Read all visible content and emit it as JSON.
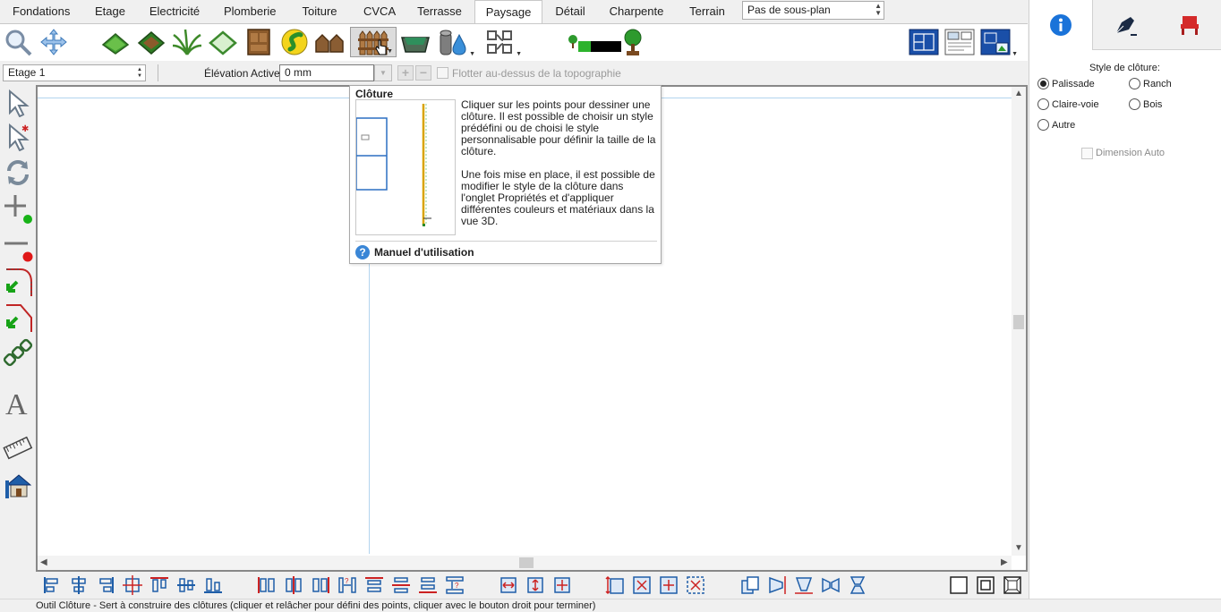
{
  "menu": {
    "tabs": [
      {
        "label": "Fondations"
      },
      {
        "label": "Etage"
      },
      {
        "label": "Electricité"
      },
      {
        "label": "Plomberie"
      },
      {
        "label": "Toiture"
      },
      {
        "label": "CVCA"
      },
      {
        "label": "Terrasse"
      },
      {
        "label": "Paysage",
        "active": true
      },
      {
        "label": "Détail"
      },
      {
        "label": "Charpente"
      },
      {
        "label": "Terrain"
      }
    ],
    "subplan_select": "Pas de sous-plan"
  },
  "toolbar": {
    "icons": [
      "zoom-icon",
      "pan-icon",
      "terrain-flat-icon",
      "terrain-slope-icon",
      "plants-icon",
      "region-icon",
      "cabinet-icon",
      "path-icon",
      "shed-icon",
      "fence-icon",
      "pool-icon",
      "water-tank-icon",
      "pattern-icon",
      "hedge-icon",
      "tree-icon"
    ],
    "selected": "fence-icon",
    "view_icons": [
      "plan-view-icon",
      "elevation-view-icon",
      "3d-view-icon"
    ]
  },
  "floor_bar": {
    "floor_select": "Etage 1",
    "elevation_label": "Élévation Active:",
    "elevation_value": "0 mm",
    "float_label": "Flotter au-dessus de la topographie"
  },
  "tooltip": {
    "title": "Clôture",
    "paragraph1": "Cliquer sur les points pour dessiner une clôture. Il est possible de choisir un style prédéfini ou de choisi le style personnalisable pour définir la taille de la clôture.",
    "paragraph2": "Une fois mise en place, il est possible de modifier le style de la clôture dans l'onglet Propriétés et d'appliquer différentes couleurs et matériaux dans la vue 3D.",
    "help_label": "Manuel d'utilisation"
  },
  "right_panel": {
    "tabs": [
      "info-icon",
      "pen-icon",
      "furniture-icon"
    ],
    "style_label": "Style de clôture:",
    "options": [
      {
        "label": "Palissade",
        "checked": true
      },
      {
        "label": "Ranch",
        "checked": false
      },
      {
        "label": "Claire-voie",
        "checked": false
      },
      {
        "label": "Bois",
        "checked": false
      },
      {
        "label": "Autre",
        "checked": false
      }
    ],
    "auto_dim_label": "Dimension Auto"
  },
  "status": {
    "text": "Outil Clôture - Sert à construire des clôtures (cliquer et relâcher pour défini des points, cliquer avec le bouton droit pour terminer)"
  },
  "colors": {
    "accent": "#1a73d9",
    "canvas_guide": "#b3d4ee",
    "fence_line": "#d9a400"
  }
}
